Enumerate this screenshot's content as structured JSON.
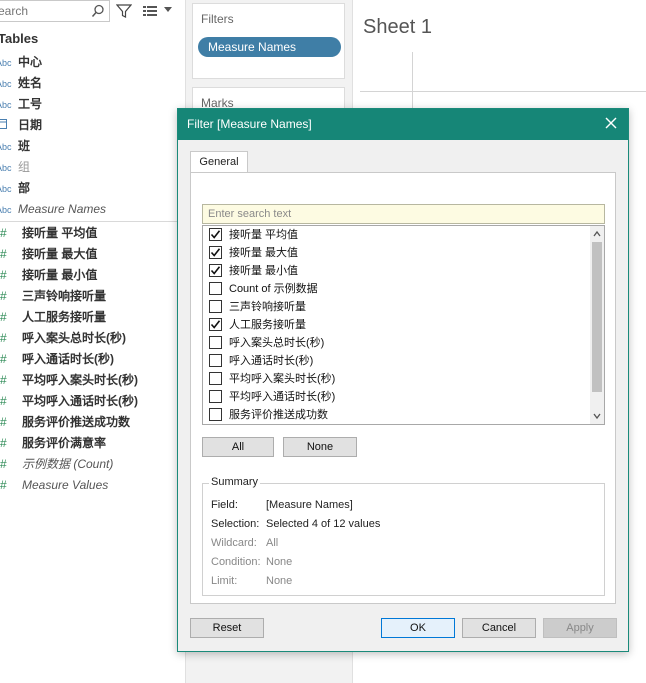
{
  "data_pane": {
    "search_placeholder": "earch",
    "tables_heading": "Tables",
    "dimensions": [
      {
        "type": "Abc",
        "label": "中心",
        "style": "bold"
      },
      {
        "type": "Abc",
        "label": "姓名",
        "style": "bold"
      },
      {
        "type": "Abc",
        "label": "工号",
        "style": "bold"
      },
      {
        "type": "calendar",
        "label": "日期",
        "style": "bold"
      },
      {
        "type": "Abc",
        "label": "班",
        "style": "bold"
      },
      {
        "type": "Abc",
        "label": "组",
        "style": "grey"
      },
      {
        "type": "Abc",
        "label": "部",
        "style": "bold"
      },
      {
        "type": "Abc",
        "label": "Measure Names",
        "style": "italic"
      }
    ],
    "measures": [
      {
        "label": "接听量 平均值",
        "style": "bold"
      },
      {
        "label": "接听量 最大值",
        "style": "bold"
      },
      {
        "label": "接听量 最小值",
        "style": "bold"
      },
      {
        "label": "三声铃响接听量",
        "style": "bold"
      },
      {
        "label": "人工服务接听量",
        "style": "bold"
      },
      {
        "label": "呼入案头总时长(秒)",
        "style": "bold"
      },
      {
        "label": "呼入通话时长(秒)",
        "style": "bold"
      },
      {
        "label": "平均呼入案头时长(秒)",
        "style": "bold"
      },
      {
        "label": "平均呼入通话时长(秒)",
        "style": "bold"
      },
      {
        "label": "服务评价推送成功数",
        "style": "bold"
      },
      {
        "label": "服务评价满意率",
        "style": "bold"
      },
      {
        "label": "示例数据 (Count)",
        "style": "italic"
      },
      {
        "label": "Measure Values",
        "style": "italic"
      }
    ]
  },
  "filters_shelf": {
    "label": "Filters",
    "pill": "Measure Names"
  },
  "marks_shelf": {
    "label": "Marks"
  },
  "sheet": {
    "title": "Sheet 1"
  },
  "dialog": {
    "title": "Filter [Measure Names]",
    "tab": "General",
    "search_placeholder": "Enter search text",
    "items": [
      {
        "label": "接听量 平均值",
        "checked": true
      },
      {
        "label": "接听量 最大值",
        "checked": true
      },
      {
        "label": "接听量 最小值",
        "checked": true
      },
      {
        "label": "Count of 示例数据",
        "checked": false
      },
      {
        "label": "三声铃响接听量",
        "checked": false
      },
      {
        "label": "人工服务接听量",
        "checked": true
      },
      {
        "label": "呼入案头总时长(秒)",
        "checked": false
      },
      {
        "label": "呼入通话时长(秒)",
        "checked": false
      },
      {
        "label": "平均呼入案头时长(秒)",
        "checked": false
      },
      {
        "label": "平均呼入通话时长(秒)",
        "checked": false
      },
      {
        "label": "服务评价推送成功数",
        "checked": false
      }
    ],
    "all_label": "All",
    "none_label": "None",
    "summary": {
      "legend": "Summary",
      "rows": [
        {
          "key": "Field:",
          "value": "[Measure Names]",
          "dim": false
        },
        {
          "key": "Selection:",
          "value": "Selected 4 of 12 values",
          "dim": false
        },
        {
          "key": "Wildcard:",
          "value": "All",
          "dim": true
        },
        {
          "key": "Condition:",
          "value": "None",
          "dim": true
        },
        {
          "key": "Limit:",
          "value": "None",
          "dim": true
        }
      ]
    },
    "buttons": {
      "reset": "Reset",
      "ok": "OK",
      "cancel": "Cancel",
      "apply": "Apply"
    }
  },
  "colors": {
    "titlebar": "#168677",
    "pill": "#3f7ea6",
    "search_bg": "#fdfbe2"
  }
}
